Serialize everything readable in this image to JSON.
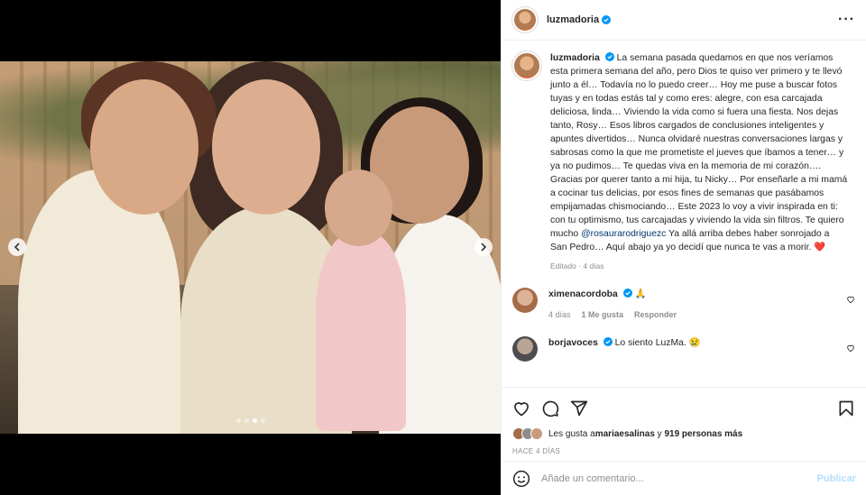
{
  "post": {
    "author": "luzmadoria",
    "caption": "La semana pasada quedamos en que nos veríamos esta primera semana del año, pero Dios te quiso ver primero y te llevó junto a él… Todavía no lo puedo creer… Hoy me puse a buscar fotos tuyas y en todas estás tal y como eres: alegre, con esa carcajada deliciosa, linda… Viviendo la vida como si fuera una fiesta. Nos dejas tanto, Rosy… Esos libros cargados de conclusiones inteligentes y apuntes divertidos… Nunca olvidaré nuestras conversaciones largas y sabrosas como la que me prometiste el jueves que íbamos a tener… y ya no pudimos… Te quedas viva en la memoria de mi corazón…. Gracias por querer tanto a mi hija, tu Nicky… Por enseñarle a mi mamá a cocinar tus delicias, por esos fines de semanas que pasábamos empijamadas chismociando… Este 2023 lo voy a vivir inspirada en ti: con tu optimismo, tus carcajadas y viviendo la vida sin filtros. Te quiero mucho ",
    "mention": "@rosaurarodriguezc",
    "caption_end": " Ya allá arriba debes haber sonrojado a San Pedro… Aquí abajo ya yo decidí que nunca te vas a morir. ",
    "heart_emoji": "❤️",
    "caption_meta": "Editado · 4 días",
    "carousel": {
      "slides": 4,
      "active_index": 2
    }
  },
  "comments": [
    {
      "user": "ximenacordoba",
      "verified": true,
      "text": "🙏",
      "age": "4 días",
      "likes": "1 Me gusta",
      "reply": "Responder"
    },
    {
      "user": "borjavoces",
      "verified": true,
      "text": "Lo siento LuzMa. 😢"
    }
  ],
  "likes": {
    "prefix": "Les gusta a ",
    "first_user": "mariaesalinas",
    "middle": " y ",
    "others": "919 personas más"
  },
  "timestamp": "HACE 4 DÍAS",
  "add_comment": {
    "placeholder": "Añade un comentario...",
    "publish": "Publicar"
  },
  "colors": {
    "verified": "#0095f6",
    "publish_disabled": "#b2dffc",
    "mention": "#00376b",
    "heart": "#e0245e"
  },
  "icons": [
    "more-icon",
    "heart-icon",
    "comment-icon",
    "share-icon",
    "save-icon",
    "emoji-icon",
    "chevron-left-icon",
    "chevron-right-icon"
  ]
}
